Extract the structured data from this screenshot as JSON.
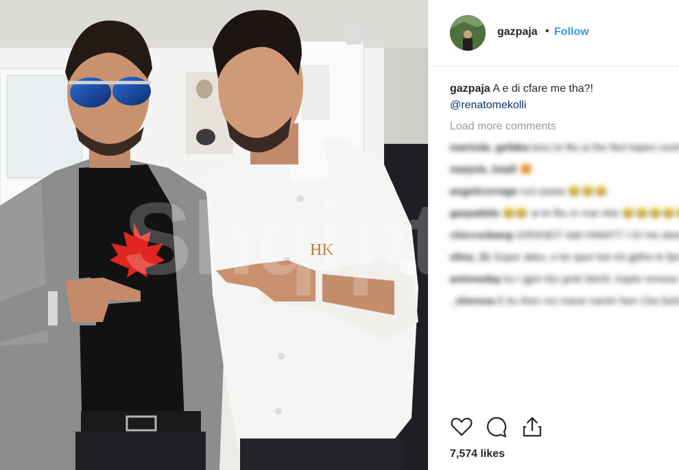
{
  "post": {
    "username": "gazpaja",
    "separator": "•",
    "follow_label": "Follow",
    "caption_user": "gazpaja",
    "caption_text": "A e di cfare me tha?!",
    "caption_mention": "@renatomekolli",
    "load_more_label": "Load more comments",
    "likes": "7,574 likes",
    "watermark": "Shqiptari.al",
    "logo_text": "HK"
  },
  "comments": [
    {
      "user": "marinda_gefaba",
      "text": "tesu te fitu ai the fitul kapen sosh sekryhe qe shqyrtig",
      "emoji": "😂😂😂"
    },
    {
      "user": "marjola_lotafi",
      "text": "",
      "emoji": "😍"
    },
    {
      "user": "angelicorrage",
      "text": "ruci pasta",
      "emoji": "😂😂😂"
    },
    {
      "user": "gazpaklds",
      "text": "😂😂 ai te fitu m mar ebe",
      "emoji": "😂😂😂😂😂😂😂😂"
    },
    {
      "user": "chiccsobang",
      "text": "GIRIIHEIT ItalI HIMATT I GI Ha olanis",
      "emoji": ""
    },
    {
      "user": "elina_31",
      "text": "Super akko, e ke qare ket mt gjithe te fjerat me koooosshh",
      "emoji": "😂😂"
    },
    {
      "user": "antoneday",
      "text": "ku i gjen ktu grek blerth, kapte mmese se i kari ardh ato renatos",
      "emoji": ""
    },
    {
      "user": "_sheresa",
      "text": "E ku then mo mave namin fare Cka farboli me gushtren blew se cfar u bapt",
      "emoji": ""
    }
  ],
  "icons": [
    "heart-icon",
    "comment-icon",
    "share-icon"
  ],
  "colors": {
    "accent": "#3897f0",
    "text": "#262626",
    "muted": "#999999",
    "mention": "#003569"
  }
}
